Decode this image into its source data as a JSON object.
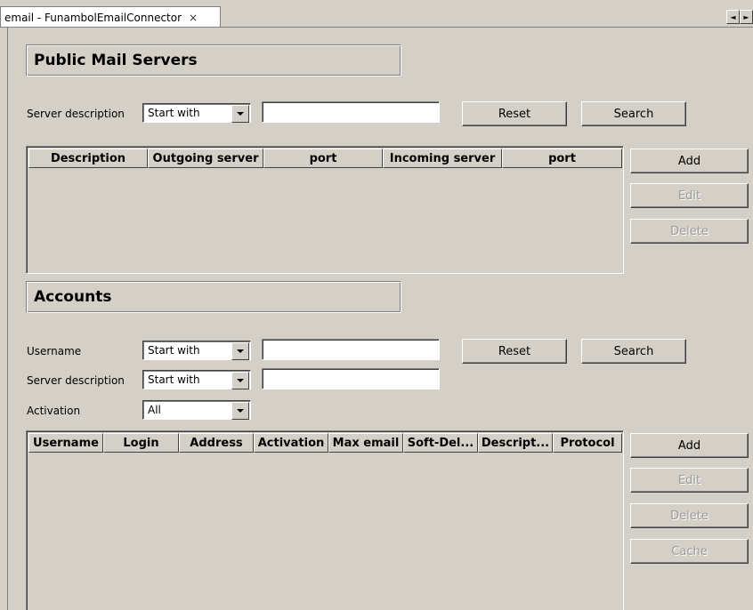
{
  "tab": {
    "title": "email - FunambolEmailConnector",
    "close": "×"
  },
  "scroll_buttons": {
    "left": "◄",
    "right": "►"
  },
  "public_servers": {
    "title": "Public Mail Servers",
    "filter_label": "Server description",
    "filter_mode": "Start with",
    "filter_value": "",
    "reset_label": "Reset",
    "search_label": "Search",
    "columns": [
      "Description",
      "Outgoing server",
      "port",
      "Incoming server",
      "port"
    ],
    "rows": [],
    "add_label": "Add",
    "edit_label": "Edit",
    "delete_label": "Delete"
  },
  "accounts": {
    "title": "Accounts",
    "username_label": "Username",
    "username_mode": "Start with",
    "username_value": "",
    "server_label": "Server description",
    "server_mode": "Start with",
    "server_value": "",
    "activation_label": "Activation",
    "activation_value": "All",
    "reset_label": "Reset",
    "search_label": "Search",
    "columns": [
      "Username",
      "Login",
      "Address",
      "Activation",
      "Max email",
      "Soft-Del...",
      "Descript...",
      "Protocol"
    ],
    "rows": [],
    "add_label": "Add",
    "edit_label": "Edit",
    "delete_label": "Delete",
    "cache_label": "Cache"
  },
  "colors": {
    "background": "#d4d0c8",
    "field": "#ffffff",
    "disabled_text": "#9a9a9a"
  }
}
